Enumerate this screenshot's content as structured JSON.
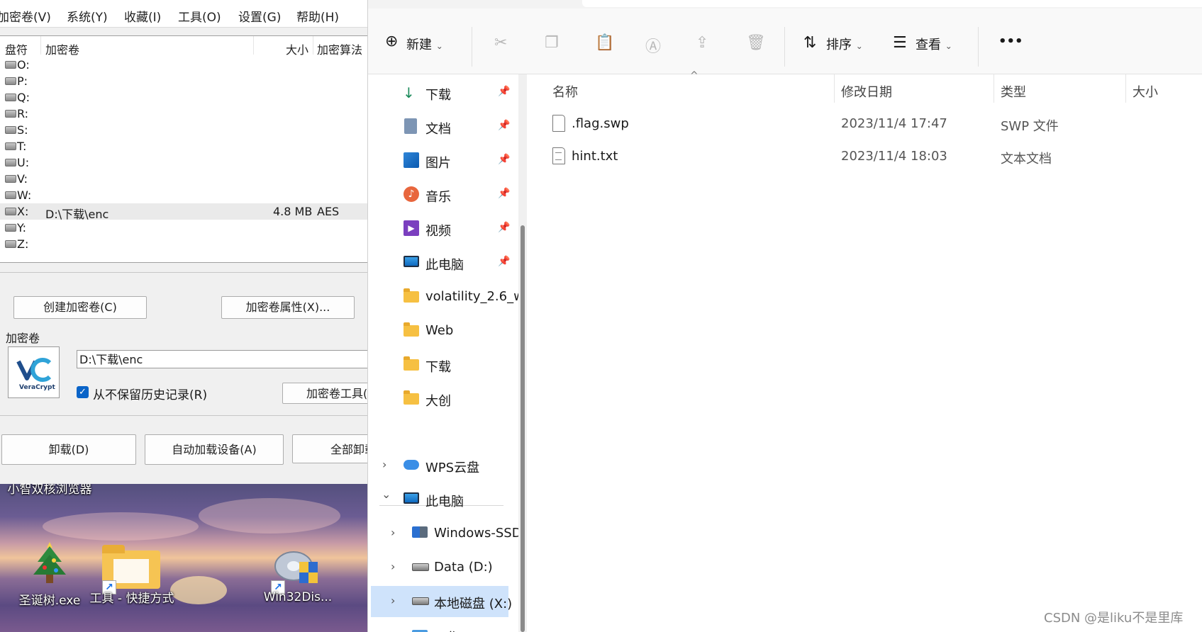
{
  "veracrypt": {
    "menu": [
      "加密卷(V)",
      "系统(Y)",
      "收藏(I)",
      "工具(O)",
      "设置(G)",
      "帮助(H)"
    ],
    "columns": {
      "drive": "盘符",
      "volume": "加密卷",
      "size": "大小",
      "algorithm": "加密算法"
    },
    "drives": [
      {
        "letter": "O:",
        "path": "",
        "size": "",
        "algo": ""
      },
      {
        "letter": "P:",
        "path": "",
        "size": "",
        "algo": ""
      },
      {
        "letter": "Q:",
        "path": "",
        "size": "",
        "algo": ""
      },
      {
        "letter": "R:",
        "path": "",
        "size": "",
        "algo": ""
      },
      {
        "letter": "S:",
        "path": "",
        "size": "",
        "algo": ""
      },
      {
        "letter": "T:",
        "path": "",
        "size": "",
        "algo": ""
      },
      {
        "letter": "U:",
        "path": "",
        "size": "",
        "algo": ""
      },
      {
        "letter": "V:",
        "path": "",
        "size": "",
        "algo": ""
      },
      {
        "letter": "W:",
        "path": "",
        "size": "",
        "algo": ""
      },
      {
        "letter": "X:",
        "path": "D:\\下载\\enc",
        "size": "4.8 MB",
        "algo": "AES"
      },
      {
        "letter": "Y:",
        "path": "",
        "size": "",
        "algo": ""
      },
      {
        "letter": "Z:",
        "path": "",
        "size": "",
        "algo": ""
      }
    ],
    "create_button": "创建加密卷(C)",
    "properties_button": "加密卷属性(X)...",
    "volume_group_label": "加密卷",
    "logo_text": "VeraCrypt",
    "volume_path": "D:\\下载\\enc",
    "never_save_history": "从不保留历史记录(R)",
    "volume_tools_button": "加密卷工具(",
    "dismount_button": "卸载(D)",
    "auto_mount_button": "自动加载设备(A)",
    "dismount_all_button": "全部卸载"
  },
  "desktop": {
    "icons": [
      {
        "label": "小智双核浏览器"
      },
      {
        "label": "圣诞树.exe"
      },
      {
        "label": "工具 - 快捷方式"
      },
      {
        "label": "Win32Dis..."
      }
    ]
  },
  "explorer": {
    "toolbar": {
      "new_label": "新建",
      "sort_label": "排序",
      "view_label": "查看",
      "more_label": "•••"
    },
    "quick_access": [
      {
        "label": "下载",
        "icon": "download-icon"
      },
      {
        "label": "文档",
        "icon": "document-icon"
      },
      {
        "label": "图片",
        "icon": "picture-icon"
      },
      {
        "label": "音乐",
        "icon": "music-icon"
      },
      {
        "label": "视频",
        "icon": "video-icon"
      },
      {
        "label": "此电脑",
        "icon": "computer-icon"
      },
      {
        "label": "volatility_2.6_w",
        "icon": "folder-icon"
      },
      {
        "label": "Web",
        "icon": "folder-icon"
      },
      {
        "label": "下载",
        "icon": "folder-icon"
      },
      {
        "label": "大创",
        "icon": "folder-icon"
      }
    ],
    "tree": [
      {
        "label": "WPS云盘",
        "expander": "›"
      },
      {
        "label": "此电脑",
        "expander": "⌄"
      },
      {
        "label": "Windows-SSD",
        "expander": "›"
      },
      {
        "label": "Data (D:)",
        "expander": "›"
      },
      {
        "label": "本地磁盘 (X:)",
        "expander": "›"
      },
      {
        "label": "工作",
        "expander": "›"
      }
    ],
    "columns": {
      "name": "名称",
      "modified": "修改日期",
      "type": "类型",
      "size": "大小"
    },
    "files": [
      {
        "name": ".flag.swp",
        "modified": "2023/11/4 17:47",
        "type": "SWP 文件"
      },
      {
        "name": "hint.txt",
        "modified": "2023/11/4 18:03",
        "type": "文本文档"
      }
    ]
  },
  "watermark": "CSDN @是liku不是里库",
  "colors": {
    "selection": "#cfe3fb",
    "accent": "#0a64c8"
  }
}
